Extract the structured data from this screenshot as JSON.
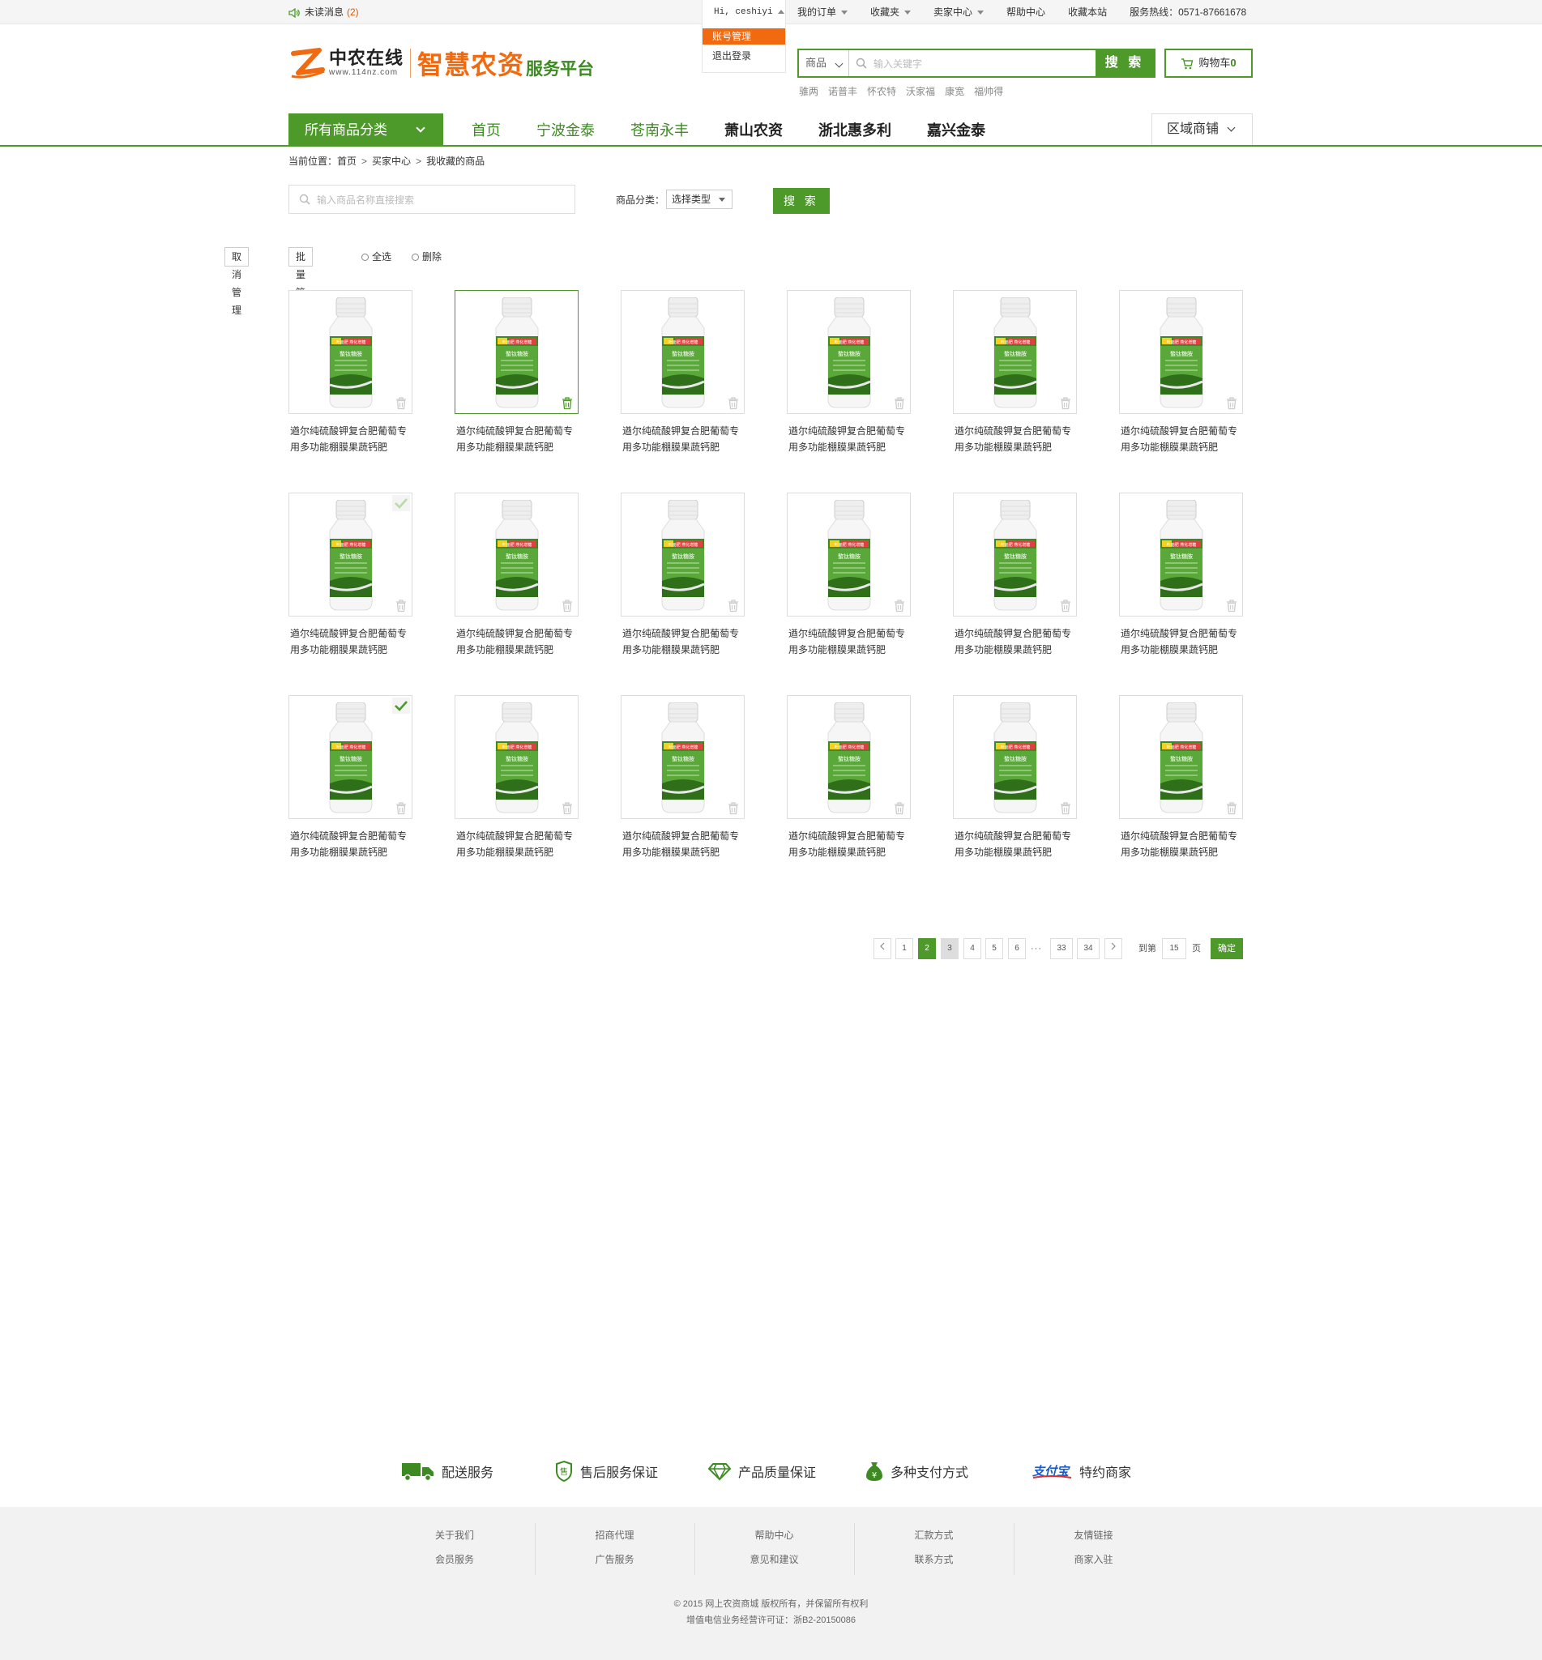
{
  "topbar": {
    "unread_label": "未读消息",
    "unread_count": "(2)",
    "greeting": "Hi, ceshiyi",
    "links": [
      "我的订单",
      "收藏夹",
      "卖家中心",
      "帮助中心",
      "收藏本站",
      "服务热线：0571-87661678"
    ],
    "account_menu": [
      "账号管理",
      "退出登录"
    ]
  },
  "logo": {
    "brand": "中农在线",
    "url": "www.114nz.com",
    "slogan": "智慧农资",
    "slogan_suffix": "服务平台"
  },
  "search": {
    "category": "商品",
    "placeholder": "输入关键字",
    "button": "搜 索",
    "hotwords": [
      "骓两",
      "诺普丰",
      "怀农特",
      "沃家福",
      "康宽",
      "福帅得"
    ]
  },
  "cart": {
    "label": "购物车",
    "count": "0"
  },
  "nav": {
    "all_categories": "所有商品分类",
    "items": [
      "首页",
      "宁波金泰",
      "苍南永丰",
      "萧山农资",
      "浙北惠多利",
      "嘉兴金泰"
    ],
    "region": "区域商铺"
  },
  "breadcrumb": {
    "prefix": "当前位置：",
    "items": [
      "首页",
      "买家中心",
      "我收藏的商品"
    ]
  },
  "filter": {
    "input_placeholder": "输入商品名称直接搜索",
    "category_label": "商品分类：",
    "category_select": "选择类型",
    "search_button": "搜 索"
  },
  "manage": {
    "cancel": "取消管理",
    "batch": "批量管理",
    "select_all": "全选",
    "delete": "删除"
  },
  "products": {
    "name_line1": "遒尔纯硫酸钾复合肥葡萄专",
    "name_line2": "用多功能棚膜果蔬钙肥",
    "label_top": "叶面肥 燕化增糖",
    "label_mid": "螯钛糖胺"
  },
  "pagination": {
    "pages": [
      "1",
      "2",
      "3",
      "4",
      "5",
      "6",
      "33",
      "34"
    ],
    "current": "2",
    "ellipsis": "···",
    "goto_label": "到第",
    "goto_value": "15",
    "page_unit": "页",
    "confirm": "确定"
  },
  "services": [
    {
      "label": "配送服务",
      "icon": "truck-icon"
    },
    {
      "label": "售后服务保证",
      "icon": "shield-icon"
    },
    {
      "label": "产品质量保证",
      "icon": "diamond-icon"
    },
    {
      "label": "多种支付方式",
      "icon": "money-bag-icon"
    },
    {
      "label": "特约商家",
      "icon": "alipay-icon",
      "logo_text": "支付宝"
    }
  ],
  "footer": {
    "columns": [
      [
        "关于我们",
        "会员服务"
      ],
      [
        "招商代理",
        "广告服务"
      ],
      [
        "帮助中心",
        "意见和建议"
      ],
      [
        "汇款方式",
        "联系方式"
      ],
      [
        "友情链接",
        "商家入驻"
      ]
    ],
    "copyright": "© 2015 网上农资商城 版权所有，并保留所有权利",
    "license": "增值电信业务经营许可证：浙B2-20150086"
  },
  "colors": {
    "green": "#4d9a2a",
    "orange": "#f26a10"
  }
}
